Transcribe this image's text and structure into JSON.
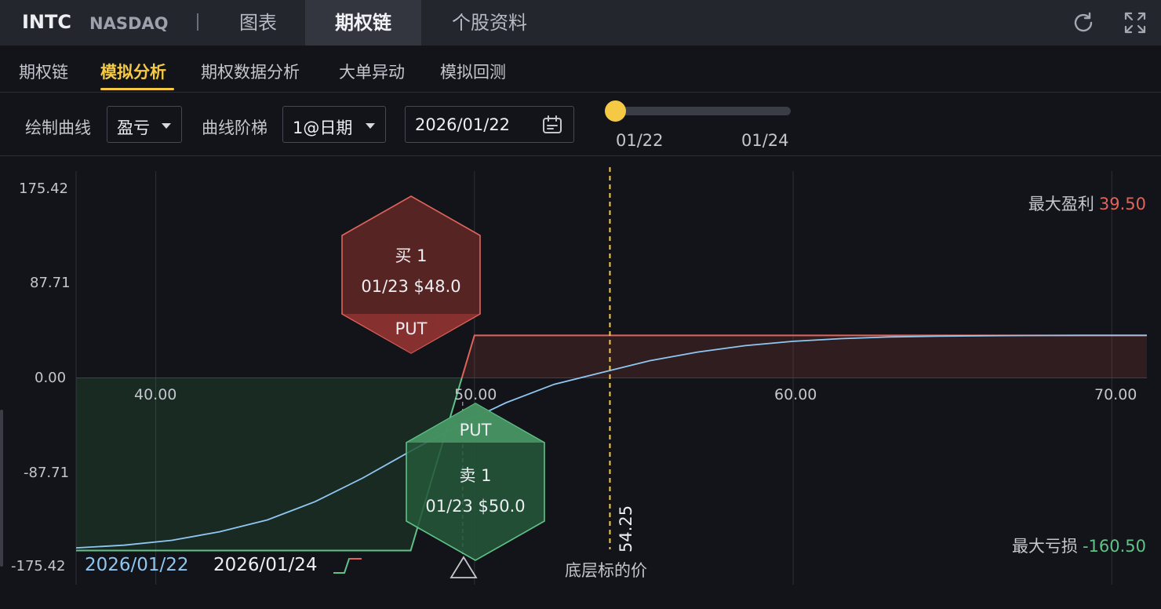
{
  "header": {
    "ticker": "INTC",
    "exchange": "NASDAQ",
    "tabs": [
      {
        "label": "图表",
        "active": false
      },
      {
        "label": "期权链",
        "active": true
      },
      {
        "label": "个股资料",
        "active": false
      }
    ],
    "icons": [
      "refresh-icon",
      "fullscreen-icon"
    ]
  },
  "subtabs": [
    {
      "label": "期权链",
      "active": false
    },
    {
      "label": "模拟分析",
      "active": true
    },
    {
      "label": "期权数据分析",
      "active": false
    },
    {
      "label": "大单异动",
      "active": false
    },
    {
      "label": "模拟回测",
      "active": false
    }
  ],
  "controls": {
    "curve_label": "绘制曲线",
    "curve_value": "盈亏",
    "step_label": "曲线阶梯",
    "step_value": "1@日期",
    "date_value": "2026/01/22",
    "slider_start": "01/22",
    "slider_end": "01/24",
    "slider_position": 0
  },
  "chart": {
    "stats": {
      "max_profit_label": "最大盈利",
      "max_profit_value": "39.50",
      "max_loss_label": "最大亏损",
      "max_loss_value": "-160.50"
    },
    "legs": [
      {
        "action": "买 1",
        "detail": "01/23 $48.0",
        "type": "PUT",
        "side": "buy"
      },
      {
        "action": "卖 1",
        "detail": "01/23 $50.0",
        "type": "PUT",
        "side": "sell"
      }
    ],
    "underlying_price": "54.25",
    "underlying_label": "底层标的价",
    "legend": [
      "2026/01/22",
      "2026/01/24"
    ]
  },
  "chart_data": {
    "type": "line",
    "xlim": [
      37.5,
      71.1
    ],
    "ylim": [
      -175.42,
      175.42
    ],
    "x_ticks": [
      "40.00",
      "50.00",
      "60.00",
      "70.00"
    ],
    "x_tick_values": [
      40,
      50,
      60,
      70
    ],
    "y_ticks": [
      "175.42",
      "87.71",
      "0.00",
      "-87.71",
      "-175.42"
    ],
    "y_tick_values": [
      175.42,
      87.71,
      0,
      -87.71,
      -175.42
    ],
    "grid": true,
    "series": [
      {
        "name": "2026/01/22",
        "color": "#8fc7f2",
        "x": [
          37.5,
          39,
          40.5,
          42,
          43.5,
          45,
          46.5,
          48,
          49.5,
          51,
          52.5,
          54,
          55.5,
          57,
          58.5,
          60,
          61.5,
          63,
          64.5,
          66,
          67.5,
          69,
          71.1
        ],
        "values": [
          -158,
          -155.5,
          -151,
          -143,
          -132,
          -115,
          -93,
          -68,
          -44,
          -23,
          -6,
          5,
          16,
          24,
          30,
          34,
          36.5,
          38,
          38.8,
          39.2,
          39.4,
          39.5,
          39.5
        ]
      },
      {
        "name": "2026/01/24",
        "color": "#5fc387",
        "x": [
          37.5,
          48,
          50,
          71.1
        ],
        "values": [
          -160.5,
          -160.5,
          39.5,
          39.5
        ]
      }
    ],
    "underlying_price": 54.25,
    "strikes": [
      48,
      50
    ]
  }
}
